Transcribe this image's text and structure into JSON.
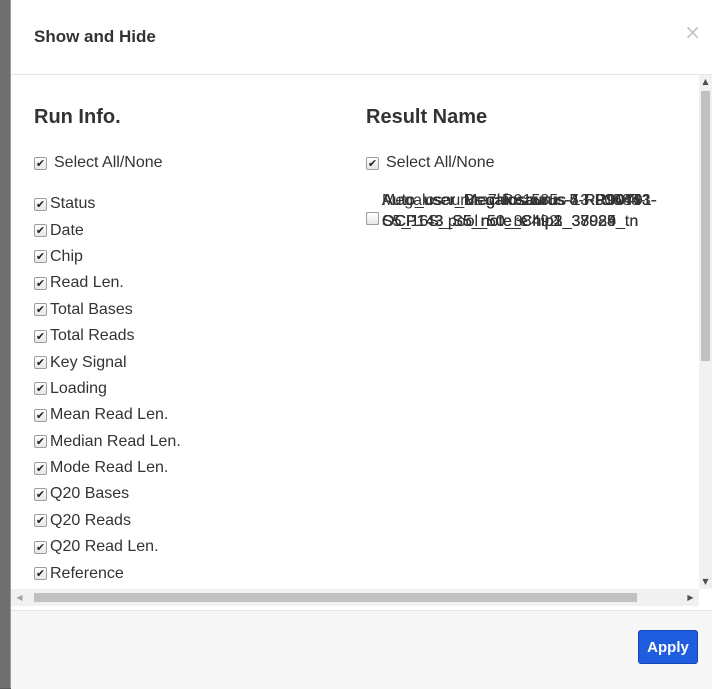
{
  "dialog": {
    "title": "Show and Hide",
    "close_glyph": "×",
    "apply_label": "Apply",
    "accent_color": "#1f5de0"
  },
  "run_info": {
    "heading": "Run Info.",
    "select_all_label": "Select All/None",
    "select_all_checked": true,
    "items": [
      {
        "label": "Status",
        "checked": true
      },
      {
        "label": "Date",
        "checked": true
      },
      {
        "label": "Chip",
        "checked": true
      },
      {
        "label": "Read Len.",
        "checked": true
      },
      {
        "label": "Total Bases",
        "checked": true
      },
      {
        "label": "Total Reads",
        "checked": true
      },
      {
        "label": "Key Signal",
        "checked": true
      },
      {
        "label": "Loading",
        "checked": true
      },
      {
        "label": "Mean Read Len.",
        "checked": true
      },
      {
        "label": "Median Read Len.",
        "checked": true
      },
      {
        "label": "Mode Read Len.",
        "checked": true
      },
      {
        "label": "Q20 Bases",
        "checked": true
      },
      {
        "label": "Q20 Reads",
        "checked": true
      },
      {
        "label": "Q20 Read Len.",
        "checked": true
      },
      {
        "label": "Reference",
        "checked": true
      }
    ]
  },
  "result_name": {
    "heading": "Result Name",
    "select_all_label": "Select All/None",
    "select_all_checked": true,
    "items": [
      {
        "line1": "Megalosaurus-7-R91585-",
        "line2": "S5_16S_pool_50_re",
        "checked": false
      },
      {
        "line1": "Auto_user_Brachiosaurus-13-R90443-",
        "line2": "OCP143_S5_note_Chip1_37924",
        "checked": true
      },
      {
        "line1": "Auto_user_Brachiosaurus-13-R90443-",
        "line2": "OCP143_S5_note_Chip1_37924_tn",
        "checked": true
      },
      {
        "line1": "Auto_user_Megalosaurus-4-R90444-",
        "line2": "OCP143_S5_note_Chip2_37925",
        "checked": false
      },
      {
        "line1": "Auto_user_Megalosaurus-4-R90444-",
        "line2": "OCP143_S5_note_Chip2_37925_tn",
        "checked": false
      },
      {
        "line1": "Auto_user_Megalosaurus-5-RR90791-",
        "line2": "OCP143_S5_note_Chip3_38089",
        "checked": false
      },
      {
        "line1": "Auto_user_Megalosaurus-5-RR90791-",
        "line2": "OCP143_S5_note_Chip3_38089_tn",
        "checked": false
      },
      {
        "line1": "Auto_user_Megalosaurus-7-R91585-",
        "line2": "S5_16S_pool_50_38492",
        "checked": false
      }
    ]
  },
  "icons": {
    "check": "✔",
    "scroll_up": "▲",
    "scroll_down": "▼",
    "scroll_left": "◀",
    "scroll_right": "▶"
  }
}
